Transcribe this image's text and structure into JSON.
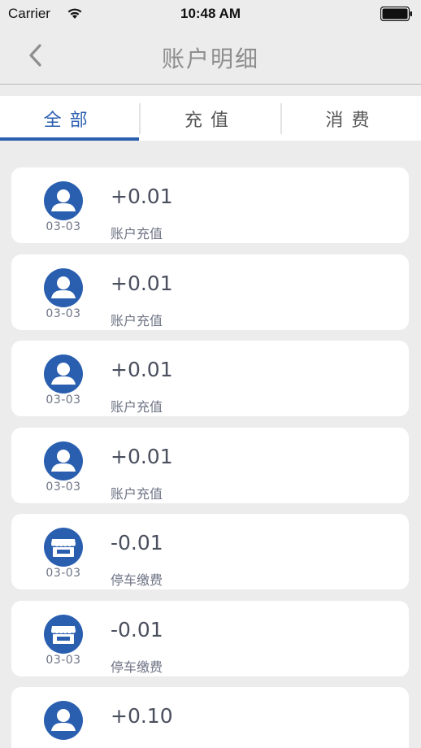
{
  "status_bar": {
    "carrier": "Carrier",
    "time": "10:48 AM"
  },
  "nav": {
    "title": "账户明细",
    "back_icon": "chevron-left-icon"
  },
  "tabs": [
    {
      "label": "全部",
      "active": true
    },
    {
      "label": "充值",
      "active": false
    },
    {
      "label": "消费",
      "active": false
    }
  ],
  "colors": {
    "accent": "#2a5fb0",
    "background": "#ececec",
    "card": "#ffffff"
  },
  "transactions": [
    {
      "icon": "person-icon",
      "date": "03-03",
      "amount": "+0.01",
      "desc": "账户充值"
    },
    {
      "icon": "person-icon",
      "date": "03-03",
      "amount": "+0.01",
      "desc": "账户充值"
    },
    {
      "icon": "person-icon",
      "date": "03-03",
      "amount": "+0.01",
      "desc": "账户充值"
    },
    {
      "icon": "person-icon",
      "date": "03-03",
      "amount": "+0.01",
      "desc": "账户充值"
    },
    {
      "icon": "store-icon",
      "date": "03-03",
      "amount": "-0.01",
      "desc": "停车缴费"
    },
    {
      "icon": "store-icon",
      "date": "03-03",
      "amount": "-0.01",
      "desc": "停车缴费"
    },
    {
      "icon": "person-icon",
      "date": "",
      "amount": "+0.10",
      "desc": ""
    }
  ]
}
